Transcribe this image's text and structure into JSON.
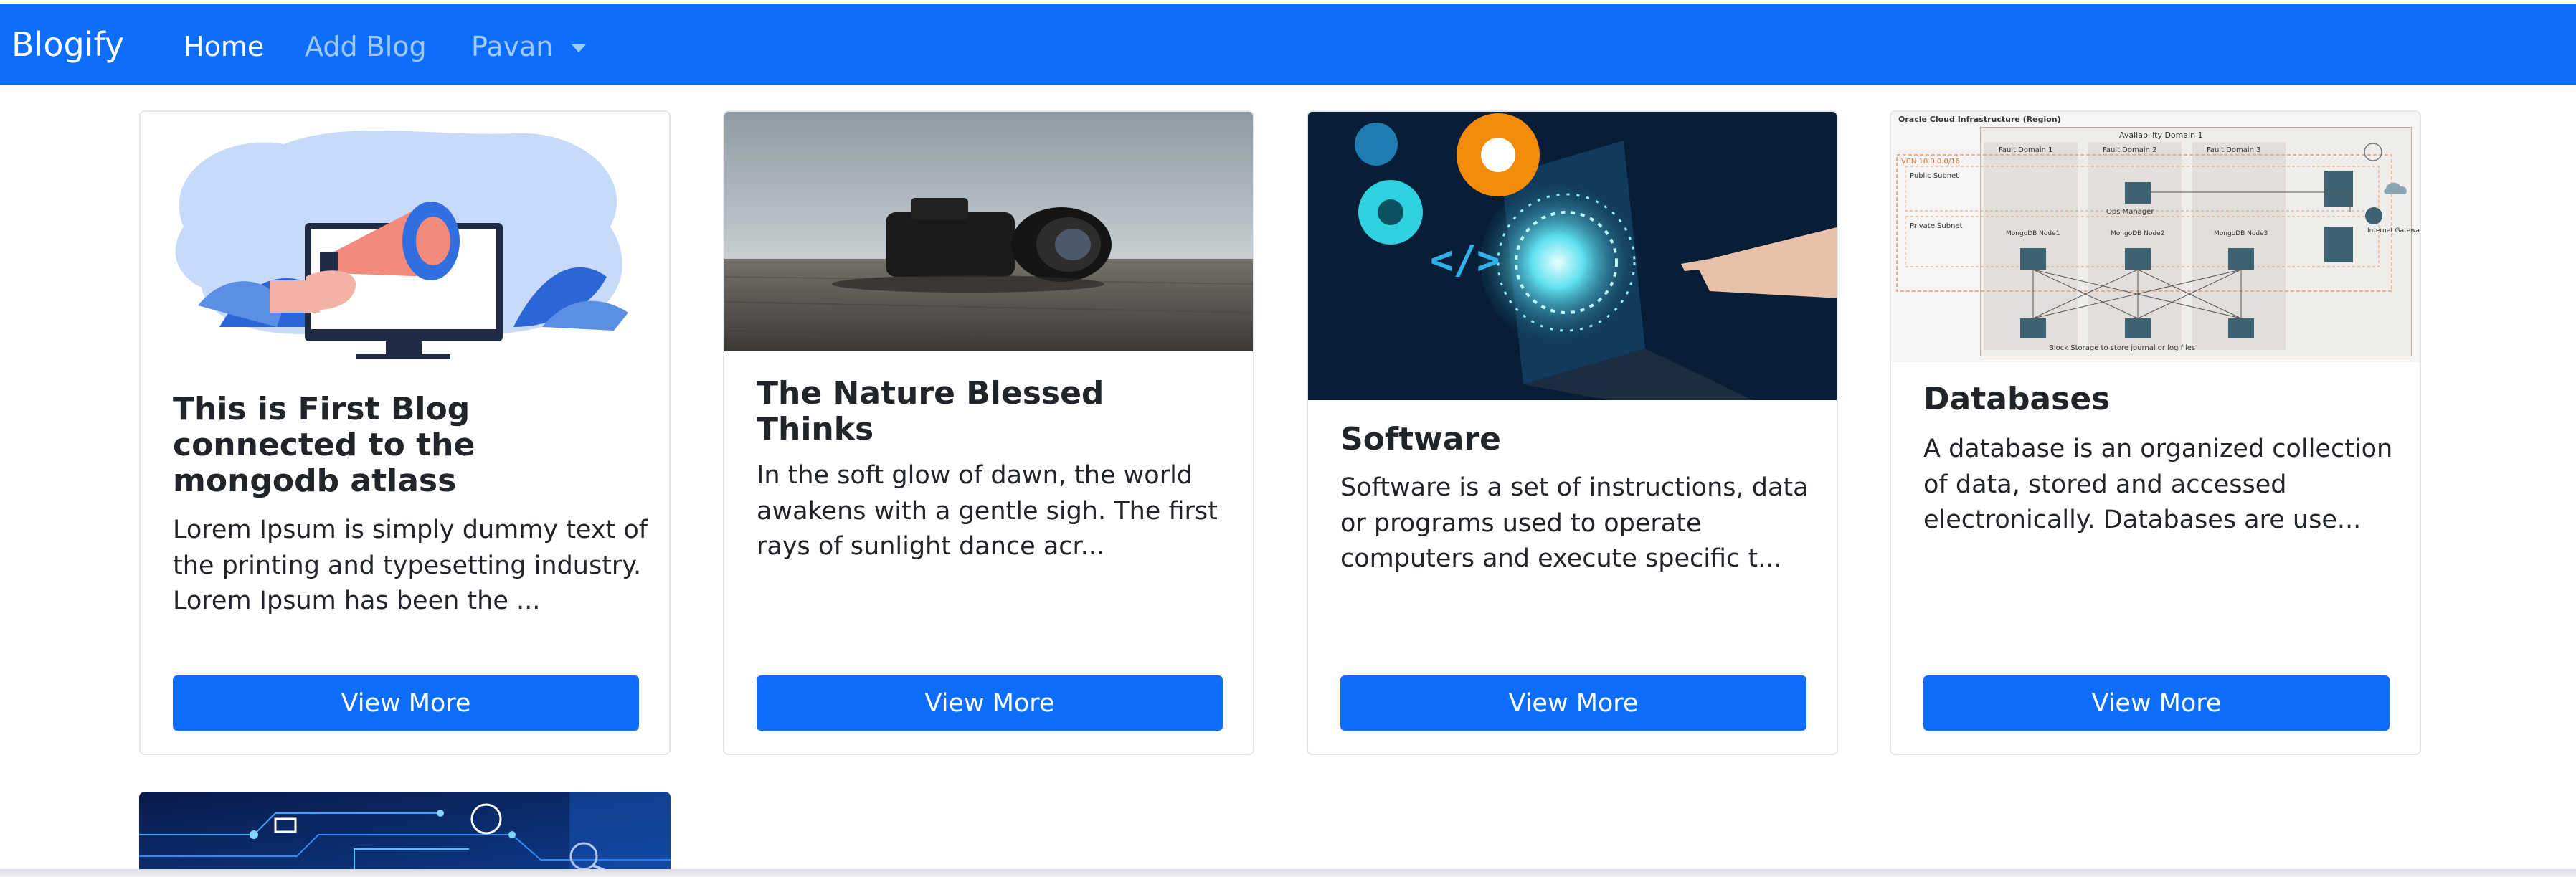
{
  "navbar": {
    "brand": "Blogify",
    "links": [
      "Home",
      "Add Blog"
    ],
    "user": "Pavan"
  },
  "cards": [
    {
      "title": "This is First Blog connected to the mongodb atlass",
      "text": "Lorem Ipsum is simply dummy text of the printing and typesetting industry. Lorem Ipsum has been the ...",
      "button": "View More",
      "image": "megaphone-monitor-illustration"
    },
    {
      "title": "The Nature Blessed Thinks",
      "text": "In the soft glow of dawn, the world awakens with a gentle sigh. The first rays of sunlight dance acr...",
      "button": "View More",
      "image": "camera-on-wooden-deck-photo"
    },
    {
      "title": "Software",
      "text": "Software is a set of instructions, data or programs used to operate computers and execute specific t...",
      "button": "View More",
      "image": "laptop-code-gears-photo"
    },
    {
      "title": "Databases",
      "text": "A database is an organized collection of data, stored and accessed electronically. Databases are use...",
      "button": "View More",
      "image": "oracle-cloud-architecture-diagram",
      "image_text": {
        "header": "Oracle Cloud Infrastructure (Region)",
        "availability_domain": "Availability Domain 1",
        "fault_domains": [
          "Fault Domain 1",
          "Fault Domain 2",
          "Fault Domain 3"
        ],
        "vcn": "VCN 10.0.0.0/16",
        "public_subnet": "Public Subnet",
        "private_subnet": "Private Subnet",
        "ops_manager": "Ops Manager",
        "nodes": [
          "MongoDB Node1",
          "MongoDB Node2",
          "MongoDB Node3"
        ],
        "gateway": "Internet Gateway",
        "storage": "Block Storage to store journal or log files"
      }
    }
  ],
  "partial_card": {
    "image": "circuit-board-ecommerce-image"
  },
  "colors": {
    "primary": "#0d6efd",
    "text": "#212529",
    "border": "#e4e7ea"
  }
}
